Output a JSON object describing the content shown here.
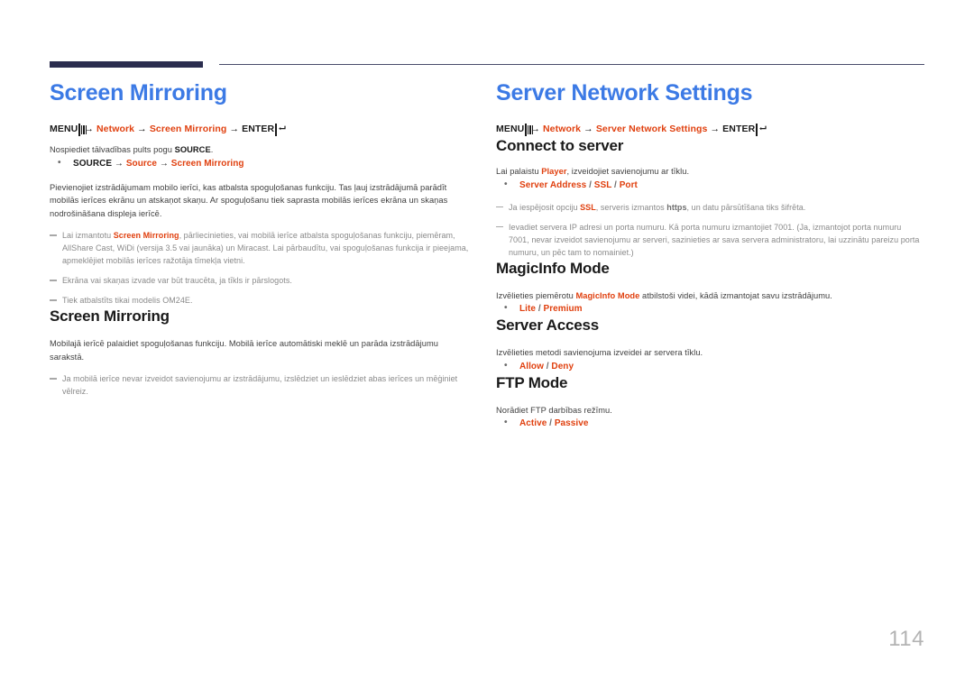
{
  "page": {
    "number": "114"
  },
  "icons": {
    "menu": "menu-key-icon",
    "enter": "enter-key-icon"
  },
  "colors": {
    "title_blue": "#3c7ae5",
    "accent_red": "#e0400f",
    "header_navy": "#2b2d4f",
    "body_gray": "#3f3f3f",
    "note_gray": "#8a8a8a",
    "page_number_gray": "#b3b3b3"
  },
  "left_column": {
    "chapter_title": "Screen Mirroring",
    "path": {
      "menu_label": "MENU",
      "arrow": "→",
      "items": [
        "Network",
        "Screen Mirroring"
      ],
      "enter_label": "ENTER"
    },
    "intro_text_pre": "Nospiediet tālvadības pults pogu ",
    "intro_text_bold": "SOURCE",
    "intro_text_post": ".",
    "bullets": [
      {
        "parts": [
          {
            "text": "SOURCE",
            "style": "black"
          },
          {
            "text": " → ",
            "style": "arrow"
          },
          {
            "text": "Source",
            "style": "red"
          },
          {
            "text": " → ",
            "style": "arrow"
          },
          {
            "text": "Screen Mirroring",
            "style": "red"
          }
        ]
      }
    ],
    "paragraph": "Pievienojiet izstrādājumam mobilo ierīci, kas atbalsta spoguļošanas funkciju. Tas ļauj izstrādājumā parādīt mobilās ierīces ekrānu un atskaņot skaņu. Ar spoguļošanu tiek saprasta mobilās ierīces ekrāna un skaņas nodrošināšana displeja ierīcē.",
    "notes": [
      {
        "parts": [
          {
            "text": "Lai izmantotu ",
            "style": "plain"
          },
          {
            "text": "Screen Mirroring",
            "style": "red"
          },
          {
            "text": ", pārliecinieties, vai mobilā ierīce atbalsta spoguļošanas funkciju, piemēram, AllShare Cast, WiDi (versija 3.5 vai jaunāka) un Miracast. Lai pārbaudītu, vai spoguļošanas funkcija ir pieejama, apmeklējiet mobilās ierīces ražotāja tīmekļa vietni.",
            "style": "plain"
          }
        ]
      },
      {
        "parts": [
          {
            "text": "Ekrāna vai skaņas izvade var būt traucēta, ja tīkls ir pārslogots.",
            "style": "plain"
          }
        ]
      },
      {
        "parts": [
          {
            "text": "Tiek atbalstīts tikai modelis OM24E.",
            "style": "plain"
          }
        ]
      }
    ],
    "section": {
      "title": "Screen Mirroring",
      "paragraph": "Mobilajā ierīcē palaidiet spoguļošanas funkciju. Mobilā ierīce automātiski meklē un parāda izstrādājumu sarakstā.",
      "notes": [
        {
          "parts": [
            {
              "text": "Ja mobilā ierīce nevar izveidot savienojumu ar izstrādājumu, izslēdziet un ieslēdziet abas ierīces un mēģiniet vēlreiz.",
              "style": "plain"
            }
          ]
        }
      ]
    }
  },
  "right_column": {
    "chapter_title": "Server Network Settings",
    "path": {
      "menu_label": "MENU",
      "arrow": "→",
      "items": [
        "Network",
        "Server Network Settings"
      ],
      "enter_label": "ENTER"
    },
    "sections": [
      {
        "title": "Connect to server",
        "paragraph_parts": [
          {
            "text": "Lai palaistu ",
            "style": "plain"
          },
          {
            "text": "Player",
            "style": "red"
          },
          {
            "text": ", izveidojiet savienojumu ar tīklu.",
            "style": "plain"
          }
        ],
        "bullets": [
          {
            "parts": [
              {
                "text": "Server Address",
                "style": "red"
              },
              {
                "text": " / ",
                "style": "sep"
              },
              {
                "text": "SSL",
                "style": "red"
              },
              {
                "text": " / ",
                "style": "sep"
              },
              {
                "text": "Port",
                "style": "red"
              }
            ]
          }
        ],
        "notes": [
          {
            "parts": [
              {
                "text": "Ja iespējosit opciju ",
                "style": "plain"
              },
              {
                "text": "SSL",
                "style": "red"
              },
              {
                "text": ", serveris izmantos ",
                "style": "plain"
              },
              {
                "text": "https",
                "style": "bold"
              },
              {
                "text": ", un datu pārsūtīšana tiks šifrēta.",
                "style": "plain"
              }
            ]
          },
          {
            "parts": [
              {
                "text": "Ievadiet servera IP adresi un porta numuru. Kā porta numuru izmantojiet 7001. (Ja, izmantojot porta numuru 7001, nevar izveidot savienojumu ar serveri, sazinieties ar sava servera administratoru, lai uzzinātu pareizu porta numuru, un pēc tam to nomainiet.)",
                "style": "plain"
              }
            ]
          }
        ]
      },
      {
        "title": "MagicInfo Mode",
        "paragraph_parts": [
          {
            "text": "Izvēlieties piemērotu ",
            "style": "plain"
          },
          {
            "text": "MagicInfo Mode",
            "style": "red"
          },
          {
            "text": " atbilstoši videi, kādā izmantojat savu izstrādājumu.",
            "style": "plain"
          }
        ],
        "bullets": [
          {
            "parts": [
              {
                "text": "Lite",
                "style": "red"
              },
              {
                "text": " / ",
                "style": "sep"
              },
              {
                "text": "Premium",
                "style": "red"
              }
            ]
          }
        ],
        "notes": []
      },
      {
        "title": "Server Access",
        "paragraph_parts": [
          {
            "text": "Izvēlieties metodi savienojuma izveidei ar servera tīklu.",
            "style": "plain"
          }
        ],
        "bullets": [
          {
            "parts": [
              {
                "text": "Allow",
                "style": "red"
              },
              {
                "text": " / ",
                "style": "sep"
              },
              {
                "text": "Deny",
                "style": "red"
              }
            ]
          }
        ],
        "notes": []
      },
      {
        "title": "FTP Mode",
        "paragraph_parts": [
          {
            "text": "Norādiet FTP darbības režīmu.",
            "style": "plain"
          }
        ],
        "bullets": [
          {
            "parts": [
              {
                "text": "Active",
                "style": "red"
              },
              {
                "text": " / ",
                "style": "sep"
              },
              {
                "text": "Passive",
                "style": "red"
              }
            ]
          }
        ],
        "notes": []
      }
    ]
  }
}
